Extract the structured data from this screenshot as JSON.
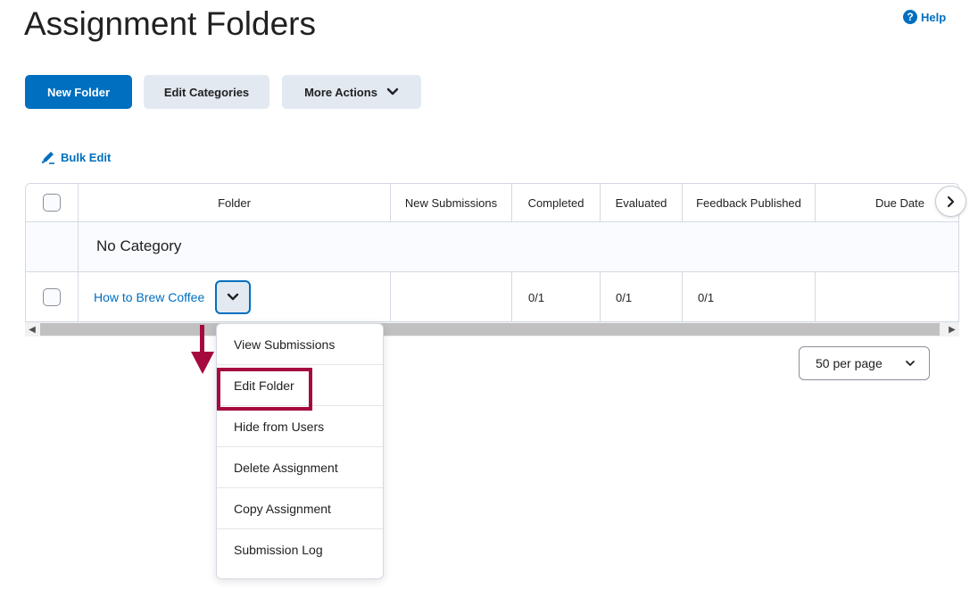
{
  "page": {
    "title": "Assignment Folders"
  },
  "help": {
    "label": "Help",
    "icon": "question-circle-icon"
  },
  "toolbar": {
    "new_folder": "New Folder",
    "edit_categories": "Edit Categories",
    "more_actions": "More Actions"
  },
  "bulk_edit": {
    "label": "Bulk Edit",
    "icon": "pencil-icon"
  },
  "table": {
    "headers": [
      "Folder",
      "New Submissions",
      "Completed",
      "Evaluated",
      "Feedback Published",
      "Due Date"
    ],
    "category": "No Category",
    "rows": [
      {
        "folder": "How to Brew Coffee",
        "new_submissions": "",
        "completed": "0/1",
        "evaluated": "0/1",
        "feedback_published": "0/1",
        "due_date": ""
      }
    ]
  },
  "pagination": {
    "per_page": "50 per page"
  },
  "context_menu": {
    "items": [
      "View Submissions",
      "Edit Folder",
      "Hide from Users",
      "Delete Assignment",
      "Copy Assignment",
      "Submission Log"
    ],
    "highlighted": "Edit Folder"
  },
  "colors": {
    "primary": "#006fbf",
    "highlight": "#a6093d",
    "secondary_btn": "#e3e9f1"
  }
}
